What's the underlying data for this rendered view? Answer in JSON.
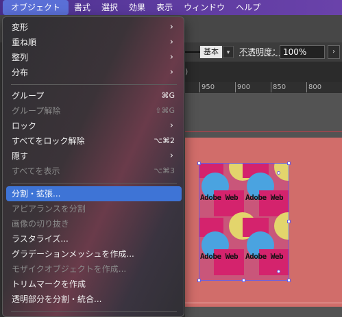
{
  "menubar": {
    "items": [
      "オブジェクト",
      "書式",
      "選択",
      "効果",
      "表示",
      "ウィンドウ",
      "ヘルプ"
    ]
  },
  "controlbar": {
    "stroke_style": "基本",
    "opacity_label": "不透明度：",
    "opacity_value": "100%",
    "tab_fragment": ")"
  },
  "ruler": {
    "ticks": [
      "950",
      "900",
      "850",
      "800"
    ]
  },
  "artwork": {
    "pattern_text": "Adobe Web"
  },
  "object_menu": {
    "items": [
      {
        "label": "変形",
        "submenu": true,
        "enabled": true
      },
      {
        "label": "重ね順",
        "submenu": true,
        "enabled": true
      },
      {
        "label": "整列",
        "submenu": true,
        "enabled": true
      },
      {
        "label": "分布",
        "submenu": true,
        "enabled": true
      },
      {
        "label": "グループ",
        "shortcut": "⌘G",
        "enabled": true
      },
      {
        "label": "グループ解除",
        "shortcut": "⇧⌘G",
        "enabled": false
      },
      {
        "label": "ロック",
        "submenu": true,
        "enabled": true
      },
      {
        "label": "すべてをロック解除",
        "shortcut": "⌥⌘2",
        "enabled": true
      },
      {
        "label": "隠す",
        "submenu": true,
        "enabled": true
      },
      {
        "label": "すべてを表示",
        "shortcut": "⌥⌘3",
        "enabled": false
      },
      {
        "label": "分割・拡張...",
        "enabled": true,
        "highlighted": true
      },
      {
        "label": "アピアランスを分割",
        "enabled": false
      },
      {
        "label": "画像の切り抜き",
        "enabled": false
      },
      {
        "label": "ラスタライズ...",
        "enabled": true
      },
      {
        "label": "グラデーションメッシュを作成...",
        "enabled": true
      },
      {
        "label": "モザイクオブジェクトを作成...",
        "enabled": false
      },
      {
        "label": "トリムマークを作成",
        "enabled": true
      },
      {
        "label": "透明部分を分割・統合...",
        "enabled": true
      }
    ],
    "submenu_glyph": "›"
  },
  "colors": {
    "menubar": "#5b3a9e",
    "highlight": "#3e74d6",
    "artboard": "#d16d6a",
    "pattern_magenta": "#d4236d",
    "pattern_blue": "#4aa3e0",
    "pattern_yellow": "#e3d56c"
  }
}
